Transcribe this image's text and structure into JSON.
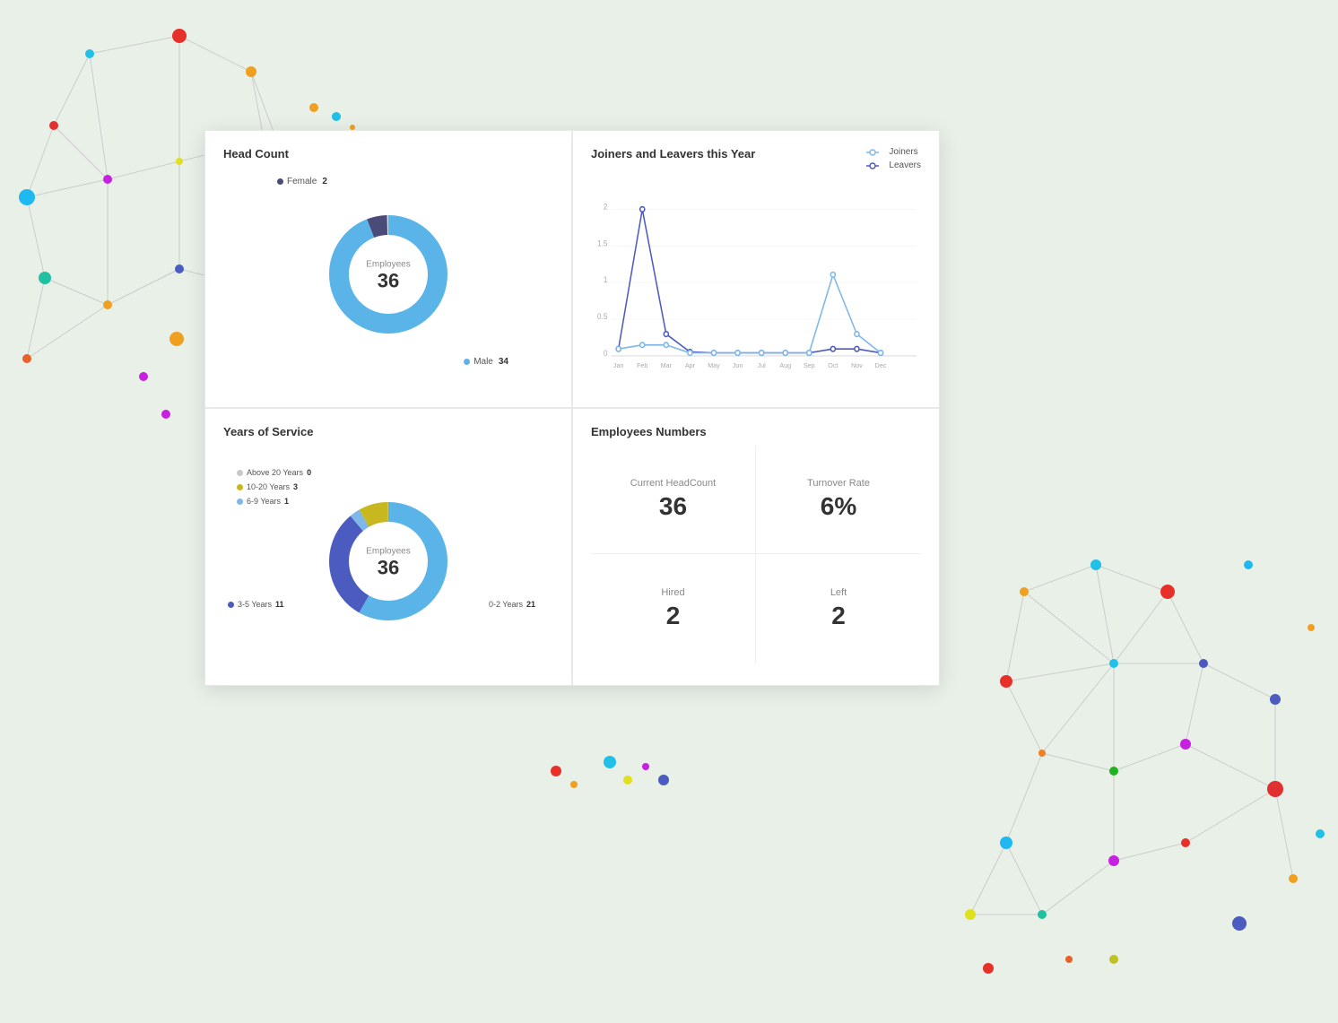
{
  "background_color": "#dde8dd",
  "dashboard": {
    "panels": {
      "head_count": {
        "title": "Head Count",
        "donut": {
          "employees_label": "Employees",
          "total": "36",
          "segments": [
            {
              "label": "Female",
              "value": 2,
              "color": "#4b4b7a",
              "percent": 5.6
            },
            {
              "label": "Male",
              "value": 34,
              "color": "#5ab4e8",
              "percent": 94.4
            }
          ]
        }
      },
      "joiners_leavers": {
        "title": "Joiners and Leavers this Year",
        "legend": [
          {
            "label": "Joiners",
            "color": "#7eb8e8"
          },
          {
            "label": "Leavers",
            "color": "#4b5bbf"
          }
        ],
        "x_labels": [
          "Jan",
          "Feb",
          "Mar",
          "Apr",
          "May",
          "Jun",
          "Jul",
          "Aug",
          "Sep",
          "Oct",
          "Nov",
          "Dec"
        ],
        "y_labels": [
          "0",
          "0.5",
          "1",
          "1.5",
          "2"
        ],
        "joiners_data": [
          0.1,
          0.15,
          0.3,
          0.1,
          0.05,
          0.05,
          0.05,
          0.05,
          0.05,
          1.1,
          0.3,
          0.05
        ],
        "leavers_data": [
          0.1,
          2.0,
          0.3,
          0.05,
          0.05,
          0.05,
          0.05,
          0.05,
          0.05,
          0.1,
          0.1,
          0.05
        ]
      },
      "years_of_service": {
        "title": "Years of Service",
        "donut": {
          "employees_label": "Employees",
          "total": "36",
          "segments": [
            {
              "label": "Above 20 Years",
              "value": 0,
              "color": "#c8c8c8",
              "percent": 0
            },
            {
              "label": "10-20 Years",
              "value": 3,
              "color": "#c8b820",
              "percent": 8.3
            },
            {
              "label": "6-9 Years",
              "value": 1,
              "color": "#7eb8e8",
              "percent": 2.8
            },
            {
              "label": "3-5 Years",
              "value": 11,
              "color": "#4b5bbf",
              "percent": 30.6
            },
            {
              "label": "0-2 Years",
              "value": 21,
              "color": "#5ab4e8",
              "percent": 58.3
            }
          ]
        }
      },
      "employees_numbers": {
        "title": "Employees Numbers",
        "metrics": [
          {
            "label": "Current HeadCount",
            "value": "36"
          },
          {
            "label": "Turnover Rate",
            "value": "6%"
          },
          {
            "label": "Hired",
            "value": "2"
          },
          {
            "label": "Left",
            "value": "2"
          }
        ]
      }
    }
  }
}
